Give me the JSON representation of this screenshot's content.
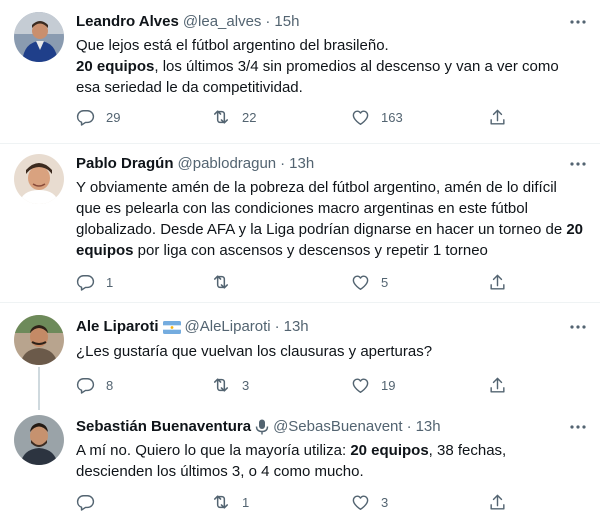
{
  "tweets": [
    {
      "name": "Leandro Alves",
      "handle": "@lea_alves",
      "sep": "·",
      "time": "15h",
      "lines": [
        [
          {
            "t": "Que lejos está el fútbol argentino del brasileño."
          }
        ],
        [
          {
            "t": "20 equipos",
            "b": true
          },
          {
            "t": ", los últimos 3/4 sin promedios al descenso y van a ver como"
          }
        ],
        [
          {
            "t": "esa seriedad le da competitividad."
          }
        ]
      ],
      "replies": "29",
      "retweets": "22",
      "likes": "163"
    },
    {
      "name": "Pablo Dragún",
      "handle": "@pablodragun",
      "sep": "·",
      "time": "13h",
      "lines": [
        [
          {
            "t": "Y obviamente amén de la pobreza del fútbol argentino, amén de lo difícil"
          }
        ],
        [
          {
            "t": "que es pelearla con las condiciones macro argentinas en este fútbol"
          }
        ],
        [
          {
            "t": "globalizado. Desde AFA y la Liga podrían dignarse en hacer un torneo de "
          },
          {
            "t": "20",
            "b": true
          }
        ],
        [
          {
            "t": "equipos",
            "b": true
          },
          {
            "t": " por liga con ascensos y descensos y repetir 1 torneo"
          }
        ]
      ],
      "replies": "1",
      "retweets": "",
      "likes": "5"
    },
    {
      "name": "Ale Liparoti",
      "handle": "@AleLiparoti",
      "sep": "·",
      "time": "13h",
      "lines": [
        [
          {
            "t": "¿Les gustaría que vuelvan los clausuras y aperturas?"
          }
        ]
      ],
      "replies": "8",
      "retweets": "3",
      "likes": "19"
    },
    {
      "name": "Sebastián Buenaventura",
      "handle": "@SebasBuenavent",
      "sep": "·",
      "time": "13h",
      "lines": [
        [
          {
            "t": "A mí no. Quiero lo que la mayoría utiliza: "
          },
          {
            "t": "20 equipos",
            "b": true
          },
          {
            "t": ", 38 fechas,"
          }
        ],
        [
          {
            "t": "descienden los últimos 3, o 4 como mucho."
          }
        ]
      ],
      "replies": "",
      "retweets": "1",
      "likes": "3"
    }
  ],
  "colors": {
    "text": "#0f1419",
    "secondary": "#536471",
    "divider": "#eff3f4",
    "argentina_blue": "#74acdf"
  },
  "icons": {
    "reply": "reply-icon",
    "retweet": "retweet-icon",
    "like": "heart-icon",
    "share": "share-icon",
    "more": "more-icon",
    "flag": "argentina-flag-icon",
    "mic": "microphone-icon"
  }
}
